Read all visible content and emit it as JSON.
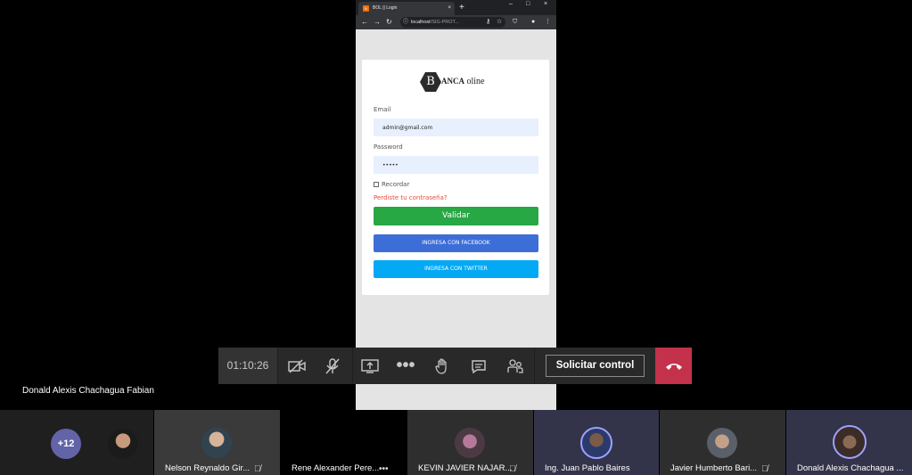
{
  "browser": {
    "tab_title": "BOL || Login",
    "tab_favicon": "B",
    "url_host": "localhost",
    "url_path": "/SIG-PROT...",
    "minimize": "–",
    "maximize": "□",
    "close": "×",
    "new_tab": "+"
  },
  "login": {
    "logo_letter": "B",
    "logo_bold": "ANCA",
    "logo_rest": " oline",
    "email_label": "Email",
    "email_value": "admin@gmail.com",
    "password_label": "Password",
    "password_value": "•••••",
    "remember_label": "Recordar",
    "forgot_link": "Perdiste tu contraseña?",
    "submit_label": "Validar",
    "facebook_label": "INGRESA CON FACEBOOK",
    "twitter_label": "INGRESA CON TWITTER",
    "colors": {
      "submit": "#28a745",
      "facebook": "#3d6dd6",
      "twitter": "#03a9f4",
      "forgot": "#e74c3c"
    }
  },
  "call_controls": {
    "timer": "01:10:26",
    "request_control_label": "Solicitar control",
    "icons": [
      "camera-off-icon",
      "mic-off-icon",
      "share-screen-icon",
      "more-icon",
      "raise-hand-icon",
      "chat-icon",
      "participants-icon",
      "hang-up-icon"
    ],
    "hangup_color": "#c4314b"
  },
  "presenter_name": "Donald Alexis Chachagua Fabian",
  "participants": {
    "overflow_count": "+12",
    "tiles": [
      {
        "name": "Nelson Reynaldo Gir...",
        "icon": "mic-off-icon"
      },
      {
        "name": "Rene Alexander Pere...",
        "icon": "more-icon"
      },
      {
        "name": "KEVIN JAVIER NAJAR...",
        "icon": "mic-off-icon"
      },
      {
        "name": "Ing. Juan Pablo Baires",
        "icon": ""
      },
      {
        "name": "Javier Humberto Bari...",
        "icon": "mic-off-icon"
      },
      {
        "name": "Donald Alexis Chachagua ...",
        "icon": ""
      }
    ]
  }
}
